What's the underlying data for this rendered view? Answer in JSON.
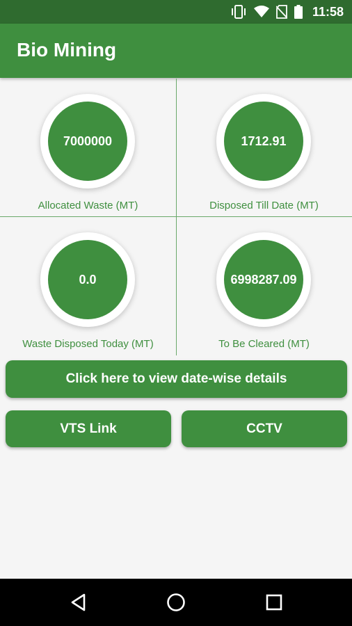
{
  "status_bar": {
    "time": "11:58",
    "icons": [
      "vibrate-icon",
      "wifi-icon",
      "no-sim-icon",
      "battery-icon"
    ]
  },
  "app_bar": {
    "title": "Bio Mining"
  },
  "stats": [
    {
      "value": "7000000",
      "label": "Allocated Waste (MT)"
    },
    {
      "value": "1712.91",
      "label": "Disposed Till Date (MT)"
    },
    {
      "value": "0.0",
      "label": "Waste Disposed Today (MT)"
    },
    {
      "value": "6998287.09",
      "label": "To Be Cleared (MT)"
    }
  ],
  "buttons": {
    "date_wise": "Click here to view date-wise details",
    "vts": "VTS Link",
    "cctv": "CCTV"
  },
  "nav_bar": {
    "icons": [
      "back-icon",
      "home-icon",
      "recents-icon"
    ]
  },
  "colors": {
    "primary": "#3f8f3f",
    "status_bar": "#2f6b2f",
    "background": "#f5f5f5"
  }
}
